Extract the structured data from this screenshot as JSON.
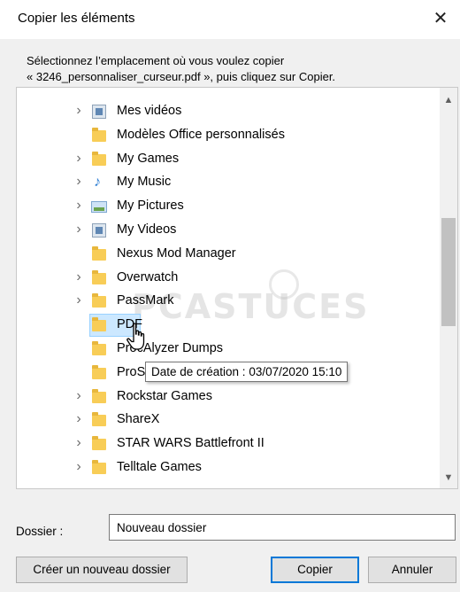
{
  "window": {
    "title": "Copier les éléments",
    "close_glyph": "✕"
  },
  "instruction": {
    "line1": "Sélectionnez l’emplacement où vous voulez copier",
    "line2": "« 3246_personnaliser_curseur.pdf », puis cliquez sur Copier."
  },
  "tree": {
    "items": [
      {
        "label": "Mes vidéos",
        "icon": "video-library-icon",
        "expandable": true
      },
      {
        "label": "Modèles Office personnalisés",
        "icon": "folder-icon",
        "expandable": false
      },
      {
        "label": "My Games",
        "icon": "folder-icon",
        "expandable": true
      },
      {
        "label": "My Music",
        "icon": "music-icon",
        "expandable": true
      },
      {
        "label": "My Pictures",
        "icon": "pictures-icon",
        "expandable": true
      },
      {
        "label": "My Videos",
        "icon": "video-library-icon",
        "expandable": true
      },
      {
        "label": "Nexus Mod Manager",
        "icon": "folder-icon",
        "expandable": false
      },
      {
        "label": "Overwatch",
        "icon": "folder-icon",
        "expandable": true
      },
      {
        "label": "PassMark",
        "icon": "folder-icon",
        "expandable": true
      },
      {
        "label": "PDF",
        "icon": "folder-icon",
        "expandable": false,
        "selected": true
      },
      {
        "label": "ProcAlyzer Dumps",
        "icon": "folder-icon",
        "expandable": false
      },
      {
        "label": "ProS",
        "icon": "folder-icon",
        "expandable": false
      },
      {
        "label": "Rockstar Games",
        "icon": "folder-icon",
        "expandable": true
      },
      {
        "label": "ShareX",
        "icon": "folder-icon",
        "expandable": true
      },
      {
        "label": "STAR WARS Battlefront II",
        "icon": "folder-icon",
        "expandable": true
      },
      {
        "label": "Telltale Games",
        "icon": "folder-icon",
        "expandable": true
      }
    ],
    "scroll_up_glyph": "▲",
    "scroll_down_glyph": "▼",
    "expand_glyph": "›"
  },
  "tooltip": {
    "text": "Date de création : 03/07/2020 15:10"
  },
  "watermark": {
    "text": "PCASTUCES"
  },
  "folder_field": {
    "label": "Dossier :",
    "value": "Nouveau dossier"
  },
  "buttons": {
    "new_folder": "Créer un nouveau dossier",
    "copy": "Copier",
    "cancel": "Annuler"
  },
  "colors": {
    "selection_fill": "#cce8ff",
    "selection_border": "#99d1ff",
    "folder": "#f8cd57",
    "default_button_border": "#0078d7"
  }
}
